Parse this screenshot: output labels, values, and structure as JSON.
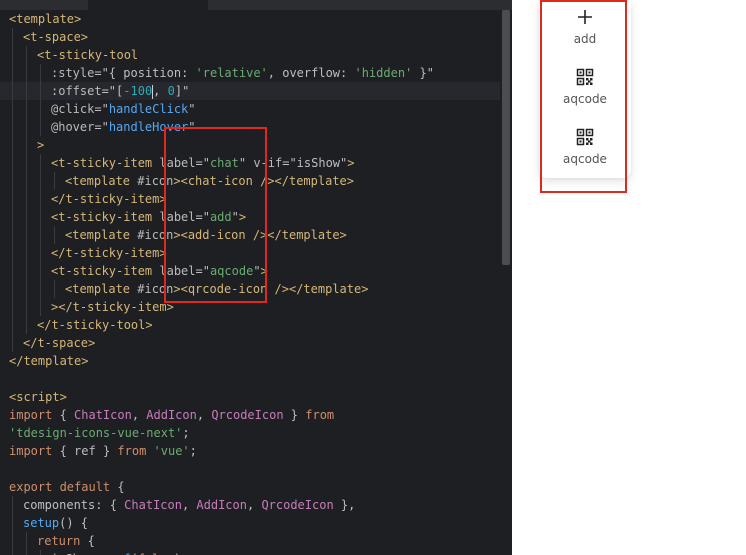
{
  "editor": {
    "lines": [
      {
        "indent": 0,
        "tokens": [
          [
            "tk-tag",
            "<template>"
          ]
        ]
      },
      {
        "indent": 1,
        "tokens": [
          [
            "tk-tag",
            "<t-space>"
          ]
        ]
      },
      {
        "indent": 2,
        "tokens": [
          [
            "tk-tag",
            "<t-sticky-tool"
          ]
        ]
      },
      {
        "indent": 3,
        "tokens": [
          [
            "tk-attr",
            ":style"
          ],
          [
            "tk-punc",
            "=\"{ "
          ],
          [
            "tk-plain",
            "position"
          ],
          [
            "tk-punc",
            ": "
          ],
          [
            "tk-str",
            "'relative'"
          ],
          [
            "tk-punc",
            ", "
          ],
          [
            "tk-plain",
            "overflow"
          ],
          [
            "tk-punc",
            ": "
          ],
          [
            "tk-str",
            "'hidden'"
          ],
          [
            "tk-punc",
            " }\""
          ]
        ]
      },
      {
        "indent": 3,
        "current": true,
        "tokens": [
          [
            "tk-attr",
            ":offset"
          ],
          [
            "tk-punc",
            "=\"["
          ],
          [
            "tk-num",
            "-100"
          ],
          [
            "cursor",
            ""
          ],
          [
            "tk-punc",
            ", "
          ],
          [
            "tk-num",
            "0"
          ],
          [
            "tk-punc",
            "]\""
          ]
        ]
      },
      {
        "indent": 3,
        "tokens": [
          [
            "tk-attr",
            "@click"
          ],
          [
            "tk-punc",
            "=\""
          ],
          [
            "tk-fn",
            "handleClick"
          ],
          [
            "tk-punc",
            "\""
          ]
        ]
      },
      {
        "indent": 3,
        "tokens": [
          [
            "tk-attr",
            "@hover"
          ],
          [
            "tk-punc",
            "=\""
          ],
          [
            "tk-fn",
            "handleHover"
          ],
          [
            "tk-punc",
            "\""
          ]
        ]
      },
      {
        "indent": 2,
        "tokens": [
          [
            "tk-tag",
            ">"
          ]
        ]
      },
      {
        "indent": 3,
        "tokens": [
          [
            "tk-tag",
            "<t-sticky-item "
          ],
          [
            "tk-attr",
            "label"
          ],
          [
            "tk-punc",
            "=\""
          ],
          [
            "tk-str",
            "chat"
          ],
          [
            "tk-punc",
            "\" "
          ],
          [
            "tk-attr",
            "v-if"
          ],
          [
            "tk-punc",
            "=\""
          ],
          [
            "tk-plain",
            "isShow"
          ],
          [
            "tk-punc",
            "\""
          ],
          [
            "tk-tag",
            ">"
          ]
        ]
      },
      {
        "indent": 4,
        "tokens": [
          [
            "tk-tag",
            "<template "
          ],
          [
            "tk-attr",
            "#icon"
          ],
          [
            "tk-tag",
            "><chat-icon /></template>"
          ]
        ]
      },
      {
        "indent": 3,
        "tokens": [
          [
            "tk-tag",
            "</t-sticky-item>"
          ]
        ]
      },
      {
        "indent": 3,
        "tokens": [
          [
            "tk-tag",
            "<t-sticky-item "
          ],
          [
            "tk-attr",
            "label"
          ],
          [
            "tk-punc",
            "=\""
          ],
          [
            "tk-str",
            "add"
          ],
          [
            "tk-punc",
            "\""
          ],
          [
            "tk-tag",
            ">"
          ]
        ]
      },
      {
        "indent": 4,
        "tokens": [
          [
            "tk-tag",
            "<template "
          ],
          [
            "tk-attr",
            "#icon"
          ],
          [
            "tk-tag",
            "><add-icon /></template>"
          ]
        ]
      },
      {
        "indent": 3,
        "tokens": [
          [
            "tk-tag",
            "</t-sticky-item>"
          ]
        ]
      },
      {
        "indent": 3,
        "tokens": [
          [
            "tk-tag",
            "<t-sticky-item "
          ],
          [
            "tk-attr",
            "label"
          ],
          [
            "tk-punc",
            "=\""
          ],
          [
            "tk-str",
            "aqcode"
          ],
          [
            "tk-punc",
            "\""
          ],
          [
            "tk-tag",
            ">"
          ]
        ]
      },
      {
        "indent": 4,
        "tokens": [
          [
            "tk-tag",
            "<template "
          ],
          [
            "tk-attr",
            "#icon"
          ],
          [
            "tk-tag",
            "><qrcode-icon /></template>"
          ]
        ]
      },
      {
        "indent": 3,
        "tokens": [
          [
            "tk-tag",
            "></t-sticky-item>"
          ]
        ]
      },
      {
        "indent": 2,
        "tokens": [
          [
            "tk-tag",
            "</t-sticky-tool>"
          ]
        ]
      },
      {
        "indent": 1,
        "tokens": [
          [
            "tk-tag",
            "</t-space>"
          ]
        ]
      },
      {
        "indent": 0,
        "tokens": [
          [
            "tk-tag",
            "</template>"
          ]
        ]
      },
      {
        "indent": 0,
        "tokens": []
      },
      {
        "indent": 0,
        "tokens": [
          [
            "tk-tag",
            "<script>"
          ]
        ]
      },
      {
        "indent": 0,
        "tokens": [
          [
            "tk-kw",
            "import "
          ],
          [
            "tk-punc",
            "{ "
          ],
          [
            "tk-cls",
            "ChatIcon"
          ],
          [
            "tk-punc",
            ", "
          ],
          [
            "tk-cls",
            "AddIcon"
          ],
          [
            "tk-punc",
            ", "
          ],
          [
            "tk-cls",
            "QrcodeIcon"
          ],
          [
            "tk-punc",
            " } "
          ],
          [
            "tk-kw",
            "from"
          ]
        ]
      },
      {
        "indent": 0,
        "tokens": [
          [
            "tk-str",
            "'tdesign-icons-vue-next'"
          ],
          [
            "tk-punc",
            ";"
          ]
        ]
      },
      {
        "indent": 0,
        "tokens": [
          [
            "tk-kw",
            "import "
          ],
          [
            "tk-punc",
            "{ "
          ],
          [
            "tk-plain",
            "ref"
          ],
          [
            "tk-punc",
            " } "
          ],
          [
            "tk-kw",
            "from "
          ],
          [
            "tk-str",
            "'vue'"
          ],
          [
            "tk-punc",
            ";"
          ]
        ]
      },
      {
        "indent": 0,
        "tokens": []
      },
      {
        "indent": 0,
        "tokens": [
          [
            "tk-kw",
            "export default "
          ],
          [
            "tk-punc",
            "{"
          ]
        ]
      },
      {
        "indent": 1,
        "tokens": [
          [
            "tk-plain",
            "components"
          ],
          [
            "tk-punc",
            ": { "
          ],
          [
            "tk-cls",
            "ChatIcon"
          ],
          [
            "tk-punc",
            ", "
          ],
          [
            "tk-cls",
            "AddIcon"
          ],
          [
            "tk-punc",
            ", "
          ],
          [
            "tk-cls",
            "QrcodeIcon"
          ],
          [
            "tk-punc",
            " },"
          ]
        ]
      },
      {
        "indent": 1,
        "tokens": [
          [
            "tk-fn",
            "setup"
          ],
          [
            "tk-punc",
            "() {"
          ]
        ]
      },
      {
        "indent": 2,
        "tokens": [
          [
            "tk-kw",
            "return "
          ],
          [
            "tk-punc",
            "{"
          ]
        ]
      },
      {
        "indent": 3,
        "tokens": [
          [
            "tk-plain",
            "isShow"
          ],
          [
            "tk-punc",
            ": "
          ],
          [
            "tk-fn",
            "ref"
          ],
          [
            "tk-punc",
            "("
          ],
          [
            "tk-kw",
            "false"
          ],
          [
            "tk-punc",
            "),"
          ]
        ]
      }
    ]
  },
  "sticky_tool": {
    "items": [
      {
        "label": "add",
        "icon": "add-icon"
      },
      {
        "label": "aqcode",
        "icon": "qrcode-icon"
      },
      {
        "label": "aqcode",
        "icon": "qrcode-icon"
      }
    ]
  },
  "colors": {
    "editor_bg": "#1e1f22",
    "highlight_box": "#e0281e",
    "tag": "#d5b778",
    "string": "#6aab73",
    "keyword": "#cf8e6d"
  }
}
